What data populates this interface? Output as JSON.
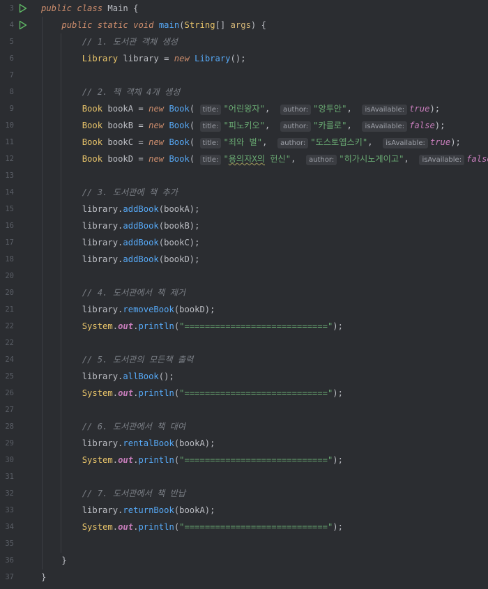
{
  "editor": {
    "lines": [
      {
        "n": "3",
        "tokens": [
          [
            "kwi",
            "public"
          ],
          [
            "cls",
            " "
          ],
          [
            "kwi",
            "class"
          ],
          [
            "cls",
            " Main {"
          ]
        ],
        "run": true
      },
      {
        "n": "4",
        "tokens": [
          [
            "cls",
            "    "
          ],
          [
            "kwi",
            "public"
          ],
          [
            "cls",
            " "
          ],
          [
            "kwi",
            "static"
          ],
          [
            "cls",
            " "
          ],
          [
            "kwi",
            "void"
          ],
          [
            "cls",
            " "
          ],
          [
            "fn",
            "main"
          ],
          [
            "cls",
            "("
          ],
          [
            "typ",
            "String"
          ],
          [
            "cls",
            "[] "
          ],
          [
            "par",
            "args"
          ],
          [
            "cls",
            ") {"
          ]
        ],
        "run": true
      },
      {
        "n": "5",
        "tokens": [
          [
            "cls",
            "        "
          ],
          [
            "cm",
            "// 1. 도서관 객체 생성"
          ]
        ]
      },
      {
        "n": "6",
        "tokens": [
          [
            "cls",
            "        "
          ],
          [
            "typ",
            "Library"
          ],
          [
            "cls",
            " library = "
          ],
          [
            "kwi",
            "new"
          ],
          [
            "cls",
            " "
          ],
          [
            "fn",
            "Library"
          ],
          [
            "cls",
            "();"
          ]
        ]
      },
      {
        "n": "7",
        "tokens": []
      },
      {
        "n": "8",
        "tokens": [
          [
            "cls",
            "        "
          ],
          [
            "cm",
            "// 2. 책 객체 4개 생성"
          ]
        ]
      },
      {
        "n": "9",
        "tokens": [
          [
            "cls",
            "        "
          ],
          [
            "typ",
            "Book"
          ],
          [
            "cls",
            " bookA = "
          ],
          [
            "kwi",
            "new"
          ],
          [
            "cls",
            " "
          ],
          [
            "fn",
            "Book"
          ],
          [
            "cls",
            "( "
          ],
          [
            "hint",
            "title:"
          ],
          [
            "str",
            "\"어린왕자\""
          ],
          [
            "cls",
            ",  "
          ],
          [
            "hint",
            "author:"
          ],
          [
            "str",
            "\"앙투안\""
          ],
          [
            "cls",
            ",  "
          ],
          [
            "hint",
            "isAvailable:"
          ],
          [
            "lit",
            "true"
          ],
          [
            "cls",
            ");"
          ]
        ]
      },
      {
        "n": "10",
        "tokens": [
          [
            "cls",
            "        "
          ],
          [
            "typ",
            "Book"
          ],
          [
            "cls",
            " bookB = "
          ],
          [
            "kwi",
            "new"
          ],
          [
            "cls",
            " "
          ],
          [
            "fn",
            "Book"
          ],
          [
            "cls",
            "( "
          ],
          [
            "hint",
            "title:"
          ],
          [
            "str",
            "\"피노키오\""
          ],
          [
            "cls",
            ",  "
          ],
          [
            "hint",
            "author:"
          ],
          [
            "str",
            "\"카를로\""
          ],
          [
            "cls",
            ",  "
          ],
          [
            "hint",
            "isAvailable:"
          ],
          [
            "lit",
            "false"
          ],
          [
            "cls",
            ");"
          ]
        ]
      },
      {
        "n": "11",
        "tokens": [
          [
            "cls",
            "        "
          ],
          [
            "typ",
            "Book"
          ],
          [
            "cls",
            " bookC = "
          ],
          [
            "kwi",
            "new"
          ],
          [
            "cls",
            " "
          ],
          [
            "fn",
            "Book"
          ],
          [
            "cls",
            "( "
          ],
          [
            "hint",
            "title:"
          ],
          [
            "str",
            "\"죄와 벌\""
          ],
          [
            "cls",
            ",  "
          ],
          [
            "hint",
            "author:"
          ],
          [
            "str",
            "\"도스토옙스키\""
          ],
          [
            "cls",
            ",  "
          ],
          [
            "hint",
            "isAvailable:"
          ],
          [
            "lit",
            "true"
          ],
          [
            "cls",
            ");"
          ]
        ]
      },
      {
        "n": "12",
        "tokens": [
          [
            "cls",
            "        "
          ],
          [
            "typ",
            "Book"
          ],
          [
            "cls",
            " bookD = "
          ],
          [
            "kwi",
            "new"
          ],
          [
            "cls",
            " "
          ],
          [
            "fn",
            "Book"
          ],
          [
            "cls",
            "( "
          ],
          [
            "hint",
            "title:"
          ],
          [
            "str",
            "\""
          ],
          [
            "squig",
            "용의자X의"
          ],
          [
            "str",
            " 헌신\""
          ],
          [
            "cls",
            ",  "
          ],
          [
            "hint",
            "author:"
          ],
          [
            "str",
            "\"히가시노게이고\""
          ],
          [
            "cls",
            ",  "
          ],
          [
            "hint",
            "isAvailable:"
          ],
          [
            "lit",
            "false"
          ],
          [
            "cls",
            ");"
          ]
        ]
      },
      {
        "n": "13",
        "tokens": []
      },
      {
        "n": "14",
        "tokens": [
          [
            "cls",
            "        "
          ],
          [
            "cm",
            "// 3. 도서관에 책 추가"
          ]
        ]
      },
      {
        "n": "15",
        "tokens": [
          [
            "cls",
            "        library."
          ],
          [
            "fn",
            "addBook"
          ],
          [
            "cls",
            "(bookA);"
          ]
        ]
      },
      {
        "n": "16",
        "tokens": [
          [
            "cls",
            "        library."
          ],
          [
            "fn",
            "addBook"
          ],
          [
            "cls",
            "(bookB);"
          ]
        ]
      },
      {
        "n": "17",
        "tokens": [
          [
            "cls",
            "        library."
          ],
          [
            "fn",
            "addBook"
          ],
          [
            "cls",
            "(bookC);"
          ]
        ]
      },
      {
        "n": "18",
        "tokens": [
          [
            "cls",
            "        library."
          ],
          [
            "fn",
            "addBook"
          ],
          [
            "cls",
            "(bookD);"
          ]
        ]
      },
      {
        "n": "20",
        "tokens": []
      },
      {
        "n": "20",
        "tokens": [
          [
            "cls",
            "        "
          ],
          [
            "cm",
            "// 4. 도서관에서 책 제거"
          ]
        ]
      },
      {
        "n": "21",
        "tokens": [
          [
            "cls",
            "        library."
          ],
          [
            "fn",
            "removeBook"
          ],
          [
            "cls",
            "(bookD);"
          ]
        ]
      },
      {
        "n": "22",
        "tokens": [
          [
            "cls",
            "        "
          ],
          [
            "typ",
            "System"
          ],
          [
            "cls",
            "."
          ],
          [
            "fld",
            "out"
          ],
          [
            "cls",
            "."
          ],
          [
            "fn",
            "println"
          ],
          [
            "cls",
            "("
          ],
          [
            "str",
            "\"============================\""
          ],
          [
            "cls",
            ");"
          ]
        ]
      },
      {
        "n": "22",
        "tokens": []
      },
      {
        "n": "24",
        "tokens": [
          [
            "cls",
            "        "
          ],
          [
            "cm",
            "// 5. 도서관의 모든책 출력"
          ]
        ]
      },
      {
        "n": "25",
        "tokens": [
          [
            "cls",
            "        library."
          ],
          [
            "fn",
            "allBook"
          ],
          [
            "cls",
            "();"
          ]
        ]
      },
      {
        "n": "26",
        "tokens": [
          [
            "cls",
            "        "
          ],
          [
            "typ",
            "System"
          ],
          [
            "cls",
            "."
          ],
          [
            "fld",
            "out"
          ],
          [
            "cls",
            "."
          ],
          [
            "fn",
            "println"
          ],
          [
            "cls",
            "("
          ],
          [
            "str",
            "\"============================\""
          ],
          [
            "cls",
            ");"
          ]
        ]
      },
      {
        "n": "27",
        "tokens": []
      },
      {
        "n": "28",
        "tokens": [
          [
            "cls",
            "        "
          ],
          [
            "cm",
            "// 6. 도서관에서 책 대여"
          ]
        ]
      },
      {
        "n": "29",
        "tokens": [
          [
            "cls",
            "        library."
          ],
          [
            "fn",
            "rentalBook"
          ],
          [
            "cls",
            "(bookA);"
          ]
        ]
      },
      {
        "n": "30",
        "tokens": [
          [
            "cls",
            "        "
          ],
          [
            "typ",
            "System"
          ],
          [
            "cls",
            "."
          ],
          [
            "fld",
            "out"
          ],
          [
            "cls",
            "."
          ],
          [
            "fn",
            "println"
          ],
          [
            "cls",
            "("
          ],
          [
            "str",
            "\"============================\""
          ],
          [
            "cls",
            ");"
          ]
        ]
      },
      {
        "n": "31",
        "tokens": []
      },
      {
        "n": "32",
        "tokens": [
          [
            "cls",
            "        "
          ],
          [
            "cm",
            "// 7. 도서관에서 책 반납"
          ]
        ]
      },
      {
        "n": "33",
        "tokens": [
          [
            "cls",
            "        library."
          ],
          [
            "fn",
            "returnBook"
          ],
          [
            "cls",
            "(bookA);"
          ]
        ]
      },
      {
        "n": "34",
        "tokens": [
          [
            "cls",
            "        "
          ],
          [
            "typ",
            "System"
          ],
          [
            "cls",
            "."
          ],
          [
            "fld",
            "out"
          ],
          [
            "cls",
            "."
          ],
          [
            "fn",
            "println"
          ],
          [
            "cls",
            "("
          ],
          [
            "str",
            "\"============================\""
          ],
          [
            "cls",
            ");"
          ]
        ]
      },
      {
        "n": "35",
        "tokens": []
      },
      {
        "n": "36",
        "tokens": [
          [
            "cls",
            "    }"
          ]
        ]
      },
      {
        "n": "37",
        "tokens": [
          [
            "cls",
            "}"
          ]
        ]
      }
    ]
  },
  "colors": {
    "background": "#2b2d31",
    "keyword": "#cf8e6d",
    "string": "#6aab73",
    "comment": "#7a7e85",
    "method": "#56a8f5",
    "type": "#e8c46a",
    "literal": "#c77dbb",
    "run_icon": "#5fb865"
  },
  "icons": {
    "run": "run-triangle-icon"
  }
}
